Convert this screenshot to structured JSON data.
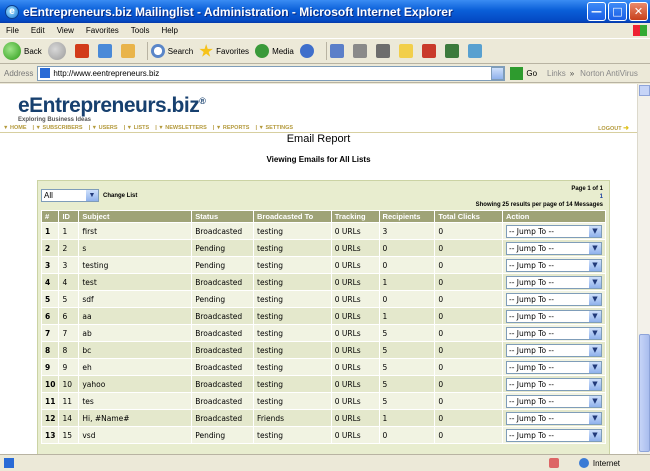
{
  "window": {
    "title": "eEntrepreneurs.biz Mailinglist - Administration - Microsoft Internet Explorer"
  },
  "menubar": [
    "File",
    "Edit",
    "View",
    "Favorites",
    "Tools",
    "Help"
  ],
  "toolbar": {
    "back": "Back",
    "search": "Search",
    "favorites": "Favorites",
    "media": "Media"
  },
  "address": {
    "label": "Address",
    "url": "http://www.eentrepreneurs.biz",
    "go": "Go",
    "links": "Links",
    "norton": "Norton AntiVirus"
  },
  "logo": {
    "name": "eEntrepreneurs.biz",
    "tagline": "Exploring Business Ideas"
  },
  "nav": {
    "items": [
      "HOME",
      "SUBSCRIBERS",
      "USERS",
      "LISTS",
      "NEWSLETTERS",
      "REPORTS",
      "SETTINGS"
    ],
    "logout": "LOGOUT"
  },
  "report": {
    "title": "Email Report",
    "subtitle": "Viewing Emails for All Lists",
    "filter_value": "All",
    "change_list": "Change List",
    "page_info": "Page 1 of 1",
    "page_num": "1",
    "results_info": "Showing 25 results per page of 14 Messages"
  },
  "table": {
    "columns": [
      "#",
      "ID",
      "Subject",
      "Status",
      "Broadcasted To",
      "Tracking",
      "Recipients",
      "Total Clicks",
      "Action"
    ],
    "jump_label": "-- Jump To --",
    "rows": [
      {
        "num": "1",
        "id": "1",
        "subject": "first",
        "status": "Broadcasted",
        "to": "testing",
        "tracking": "0 URLs",
        "recipients": "3",
        "clicks": "0"
      },
      {
        "num": "2",
        "id": "2",
        "subject": "s",
        "status": "Pending",
        "to": "testing",
        "tracking": "0 URLs",
        "recipients": "0",
        "clicks": "0"
      },
      {
        "num": "3",
        "id": "3",
        "subject": "testing",
        "status": "Pending",
        "to": "testing",
        "tracking": "0 URLs",
        "recipients": "0",
        "clicks": "0"
      },
      {
        "num": "4",
        "id": "4",
        "subject": "test",
        "status": "Broadcasted",
        "to": "testing",
        "tracking": "0 URLs",
        "recipients": "1",
        "clicks": "0"
      },
      {
        "num": "5",
        "id": "5",
        "subject": "sdf",
        "status": "Pending",
        "to": "testing",
        "tracking": "0 URLs",
        "recipients": "0",
        "clicks": "0"
      },
      {
        "num": "6",
        "id": "6",
        "subject": "aa",
        "status": "Broadcasted",
        "to": "testing",
        "tracking": "0 URLs",
        "recipients": "1",
        "clicks": "0"
      },
      {
        "num": "7",
        "id": "7",
        "subject": "ab",
        "status": "Broadcasted",
        "to": "testing",
        "tracking": "0 URLs",
        "recipients": "5",
        "clicks": "0"
      },
      {
        "num": "8",
        "id": "8",
        "subject": "bc",
        "status": "Broadcasted",
        "to": "testing",
        "tracking": "0 URLs",
        "recipients": "5",
        "clicks": "0"
      },
      {
        "num": "9",
        "id": "9",
        "subject": "eh",
        "status": "Broadcasted",
        "to": "testing",
        "tracking": "0 URLs",
        "recipients": "5",
        "clicks": "0"
      },
      {
        "num": "10",
        "id": "10",
        "subject": "yahoo",
        "status": "Broadcasted",
        "to": "testing",
        "tracking": "0 URLs",
        "recipients": "5",
        "clicks": "0"
      },
      {
        "num": "11",
        "id": "11",
        "subject": "tes",
        "status": "Broadcasted",
        "to": "testing",
        "tracking": "0 URLs",
        "recipients": "5",
        "clicks": "0"
      },
      {
        "num": "12",
        "id": "14",
        "subject": "Hi, #Name#",
        "status": "Broadcasted",
        "to": "Friends",
        "tracking": "0 URLs",
        "recipients": "1",
        "clicks": "0"
      },
      {
        "num": "13",
        "id": "15",
        "subject": "vsd",
        "status": "Pending",
        "to": "testing",
        "tracking": "0 URLs",
        "recipients": "0",
        "clicks": "0"
      }
    ]
  },
  "status": {
    "zone": "Internet"
  }
}
